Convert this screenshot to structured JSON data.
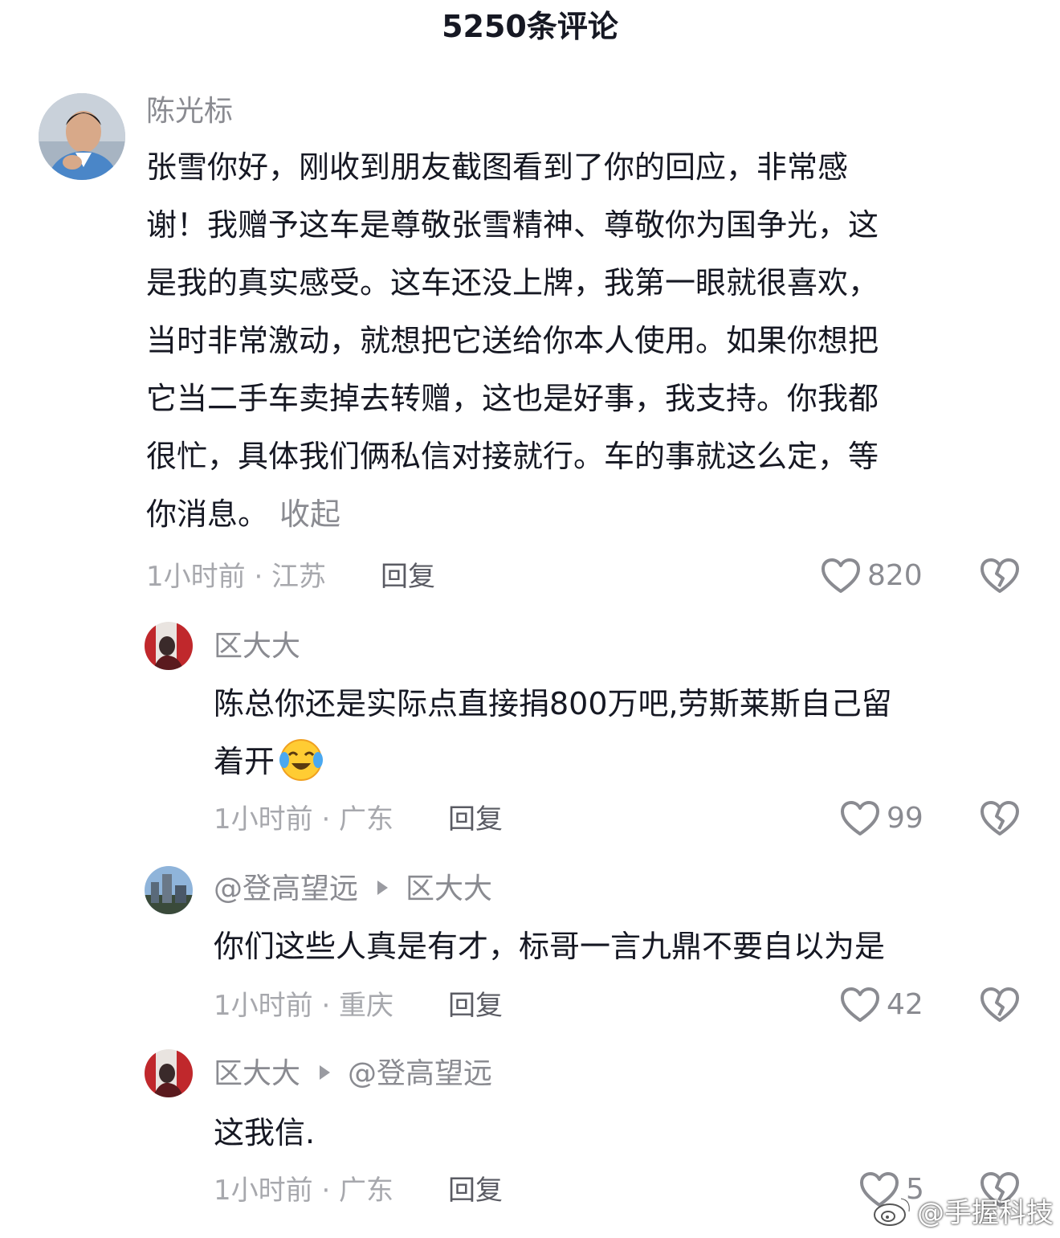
{
  "header": {
    "title": "5250条评论"
  },
  "comments": [
    {
      "user": "陈光标",
      "lines": [
        "张雪你好，刚收到朋友截图看到了你的回应，非常感",
        "谢！我赠予这车是尊敬张雪精神、尊敬你为国争光，这",
        "是我的真实感受。这车还没上牌，我第一眼就很喜欢，",
        "当时非常激动，就想把它送给你本人使用。如果你想把",
        "它当二手车卖掉去转赠，这也是好事，我支持。你我都",
        "很忙，具体我们俩私信对接就行。车的事就这么定，等",
        "你消息。"
      ],
      "collapse_label": "收起",
      "time_location": "1小时前 · 江苏",
      "reply_label": "回复",
      "likes": "820"
    },
    {
      "user": "区大大",
      "lines": [
        "陈总你还是实际点直接捐800万吧,劳斯莱斯自己留",
        "着开"
      ],
      "emoji": "crying-laughing-emoji",
      "time_location": "1小时前 · 广东",
      "reply_label": "回复",
      "likes": "99"
    },
    {
      "user": "@登高望远",
      "reply_to": "区大大",
      "lines": [
        "你们这些人真是有才，标哥一言九鼎不要自以为是"
      ],
      "time_location": "1小时前 · 重庆",
      "reply_label": "回复",
      "likes": "42"
    },
    {
      "user": "区大大",
      "reply_to": "@登高望远",
      "lines": [
        "这我信."
      ],
      "time_location": "1小时前 · 广东",
      "reply_label": "回复",
      "likes": "5"
    }
  ],
  "watermark": "@手握科技",
  "icons": {
    "like": "heart-outline-icon",
    "dislike": "broken-heart-icon",
    "watermark_logo": "weibo-logo-icon"
  },
  "colors": {
    "text": "#161823",
    "secondary": "#8a8b91",
    "meta": "#a7a8ad",
    "icon": "#8a8b91"
  }
}
